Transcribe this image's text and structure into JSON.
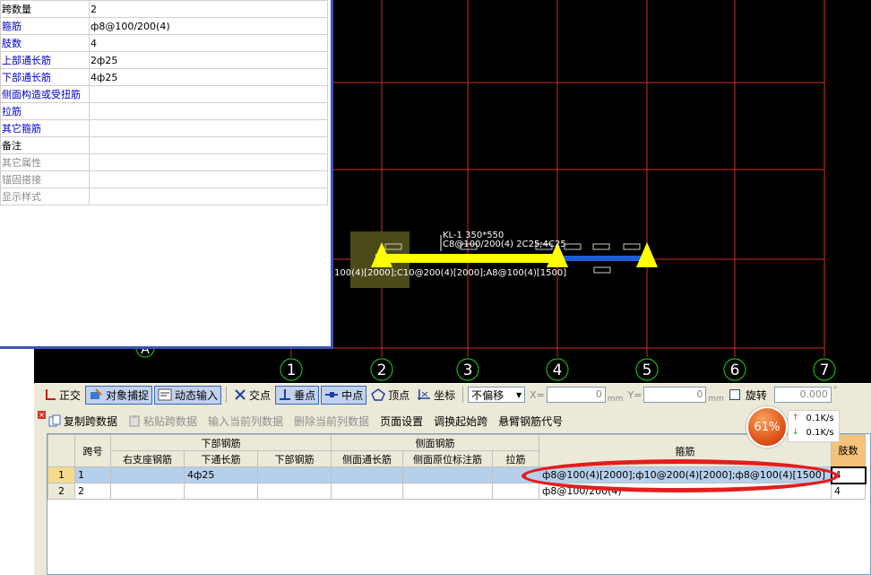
{
  "properties": [
    {
      "key": "跨数量",
      "value": "2",
      "color": "black"
    },
    {
      "key": "箍筋",
      "value": "ф8@100/200(4)",
      "color": "blue"
    },
    {
      "key": "肢数",
      "value": "4",
      "color": "blue"
    },
    {
      "key": "上部通长筋",
      "value": "2ф25",
      "color": "blue"
    },
    {
      "key": "下部通长筋",
      "value": "4ф25",
      "color": "blue"
    },
    {
      "key": "侧面构造或受扭筋",
      "value": "",
      "color": "blue"
    },
    {
      "key": "拉筋",
      "value": "",
      "color": "blue"
    },
    {
      "key": "其它箍筋",
      "value": "",
      "color": "blue"
    },
    {
      "key": "备注",
      "value": "",
      "color": "black"
    },
    {
      "key": "其它属性",
      "value": "",
      "color": "gray"
    },
    {
      "key": "锚固搭接",
      "value": "",
      "color": "gray"
    },
    {
      "key": "显示样式",
      "value": "",
      "color": "gray"
    }
  ],
  "canvas": {
    "axis_labels": [
      "1",
      "2",
      "3",
      "4",
      "5",
      "6",
      "7"
    ],
    "beam_label_line1": "KL-1 350*550",
    "beam_label_line2": "C8@100/200(4) 2C25;4C25",
    "beam_stirrup_text": "100(4)[2000];C10@200(4)[2000];A8@100(4)[1500]",
    "axis_partial_label": "A"
  },
  "toolbar": {
    "ortho": "正交",
    "snap": "对象捕捉",
    "dynamic_input": "动态输入",
    "intersection": "交点",
    "perpendicular": "垂点",
    "midpoint": "中点",
    "vertex": "顶点",
    "coordinate": "坐标",
    "offset_mode": "不偏移",
    "x_label": "X=",
    "x_value": "0",
    "y_label": "Y=",
    "y_value": "0",
    "unit": "mm",
    "rotate": "旋转",
    "rotate_value": "0.000",
    "degree": "°"
  },
  "grid_toolbar": {
    "copy_span": "复制跨数据",
    "paste_span": "粘贴跨数据",
    "input_column": "输入当前列数据",
    "delete_column": "删除当前列数据",
    "page_setup": "页面设置",
    "swap_start": "调换起始跨",
    "cantilever_code": "悬臂钢筋代号"
  },
  "grid": {
    "headers_top": {
      "span_no": "跨号",
      "bottom_rebar": "下部钢筋",
      "side_rebar": "侧面钢筋",
      "stirrup": "箍筋",
      "legs": "肢数"
    },
    "headers_sub": [
      "右支座钢筋",
      "下通长筋",
      "下部钢筋",
      "侧面通长筋",
      "侧面原位标注筋",
      "拉筋"
    ],
    "rows": [
      {
        "num": "1",
        "span": "1",
        "right_support": "",
        "bottom_through": "4ф25",
        "bottom_rebar": "",
        "side_through": "",
        "side_in_situ": "",
        "tie": "",
        "stirrup": "ф8@100(4)[2000];ф10@200(4)[2000];ф8@100(4)[1500]",
        "legs": "4"
      },
      {
        "num": "2",
        "span": "2",
        "right_support": "",
        "bottom_through": "",
        "bottom_rebar": "",
        "side_through": "",
        "side_in_situ": "",
        "tie": "",
        "stirrup": "ф8@100/200(4)",
        "legs": "4"
      }
    ]
  },
  "network": {
    "percent": "61%",
    "up": "0.1K/s",
    "down": "0.1K/s"
  },
  "colors": {
    "grid_line": "#d42a2a",
    "axis_circle": "#19b319",
    "beam_yellow": "#ffff00",
    "beam_blue": "#1c5fd6",
    "highlight_ellipse": "#e41d1d"
  }
}
